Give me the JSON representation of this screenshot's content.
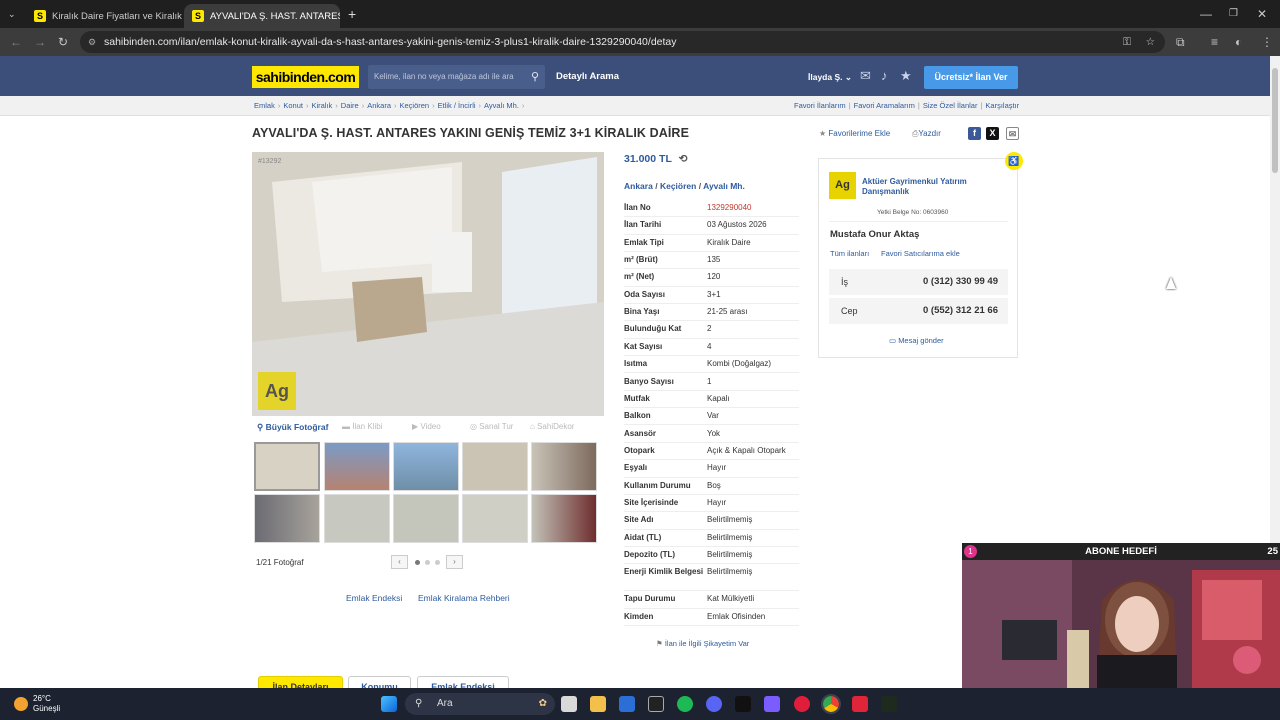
{
  "browser": {
    "tabs": [
      {
        "label": "Kiralık Daire Fiyatları ve Kiralık Ev"
      },
      {
        "label": "AYVALI'DA Ş. HAST. ANTARES YAKINI"
      }
    ],
    "url": "sahibinden.com/ilan/emlak-konut-kiralik-ayvali-da-s-hast-antares-yakini-genis-temiz-3-plus1-kiralik-daire-1329290040/detay"
  },
  "header": {
    "logo": "sahibinden.com",
    "search_placeholder": "Kelime, ilan no veya mağaza adı ile ara",
    "detailed_search": "Detaylı Arama",
    "user": "İlayda Ş.",
    "post_button": "Ücretsiz* İlan Ver"
  },
  "breadcrumbs": [
    "Emlak",
    "Konut",
    "Kiralık",
    "Daire",
    "Ankara",
    "Keçiören",
    "Etlik / İncirli",
    "Ayvalı Mh."
  ],
  "top_links": [
    "Favori İlanlarım",
    "Favori Aramalarım",
    "Size Özel İlanlar",
    "Karşılaştır"
  ],
  "listing": {
    "title": "AYVALI'DA Ş. HAST. ANTARES YAKINI GENİŞ TEMİZ 3+1 KİRALIK DAİRE",
    "add_favorite": "Favorilerime Ekle",
    "print": "Yazdır",
    "photo_id": "#13292",
    "price": "31.000 TL",
    "location": [
      "Ankara",
      "Keçiören",
      "Ayvalı Mh."
    ],
    "media_tabs": [
      "Büyük Fotoğraf",
      "İlan Klibi",
      "Video",
      "Sanal Tur",
      "SahiDekor"
    ],
    "photo_count": "1/21 Fotoğraf",
    "footer_links": [
      "Emlak Endeksi",
      "Emlak Kiralama Rehberi"
    ],
    "complaint": "İlan ile İlgili Şikayetim Var",
    "details": [
      {
        "k": "İlan No",
        "v": "1329290040",
        "red": true
      },
      {
        "k": "İlan Tarihi",
        "v": "03 Ağustos 2026"
      },
      {
        "k": "Emlak Tipi",
        "v": "Kiralık Daire"
      },
      {
        "k": "m² (Brüt)",
        "v": "135"
      },
      {
        "k": "m² (Net)",
        "v": "120"
      },
      {
        "k": "Oda Sayısı",
        "v": "3+1"
      },
      {
        "k": "Bina Yaşı",
        "v": "21-25 arası"
      },
      {
        "k": "Bulunduğu Kat",
        "v": "2"
      },
      {
        "k": "Kat Sayısı",
        "v": "4"
      },
      {
        "k": "Isıtma",
        "v": "Kombi (Doğalgaz)"
      },
      {
        "k": "Banyo Sayısı",
        "v": "1"
      },
      {
        "k": "Mutfak",
        "v": "Kapalı"
      },
      {
        "k": "Balkon",
        "v": "Var"
      },
      {
        "k": "Asansör",
        "v": "Yok"
      },
      {
        "k": "Otopark",
        "v": "Açık & Kapalı Otopark"
      },
      {
        "k": "Eşyalı",
        "v": "Hayır"
      },
      {
        "k": "Kullanım Durumu",
        "v": "Boş"
      },
      {
        "k": "Site İçerisinde",
        "v": "Hayır"
      },
      {
        "k": "Site Adı",
        "v": "Belirtilmemiş"
      },
      {
        "k": "Aidat (TL)",
        "v": "Belirtilmemiş"
      },
      {
        "k": "Depozito (TL)",
        "v": "Belirtilmemiş"
      },
      {
        "k": "Enerji Kimlik Belgesi",
        "v": "Belirtilmemiş"
      },
      {
        "k": "Tapu Durumu",
        "v": "Kat Mülkiyetli"
      },
      {
        "k": "Kimden",
        "v": "Emlak Ofisinden"
      }
    ]
  },
  "seller": {
    "company": "Aktüer Gayrimenkul Yatırım Danışmanlık",
    "license_label": "Yetki Belge No:",
    "license_no": "0603960",
    "person": "Mustafa Onur Aktaş",
    "all_listings": "Tüm ilanları",
    "add_favorite_seller": "Favori Satıcılarıma ekle",
    "phones": [
      {
        "k": "İş",
        "v": "0 (312) 330 99 49"
      },
      {
        "k": "Cep",
        "v": "0 (552) 312 21 66"
      }
    ],
    "message": "Mesaj gönder"
  },
  "bottom_tabs": [
    "İlan Detayları",
    "Konumu",
    "Emlak Endeksi"
  ],
  "overlay": {
    "goal": "ABONE HEDEFİ",
    "left_num": "1",
    "right_num": "25"
  },
  "taskbar": {
    "temp": "26°C",
    "weather": "Güneşli",
    "search": "Ara"
  },
  "colors": {
    "brand_yellow": "#ffe800",
    "header_blue": "#3b4f7a",
    "link_blue": "#2e5b9e",
    "post_button": "#489ae9"
  }
}
